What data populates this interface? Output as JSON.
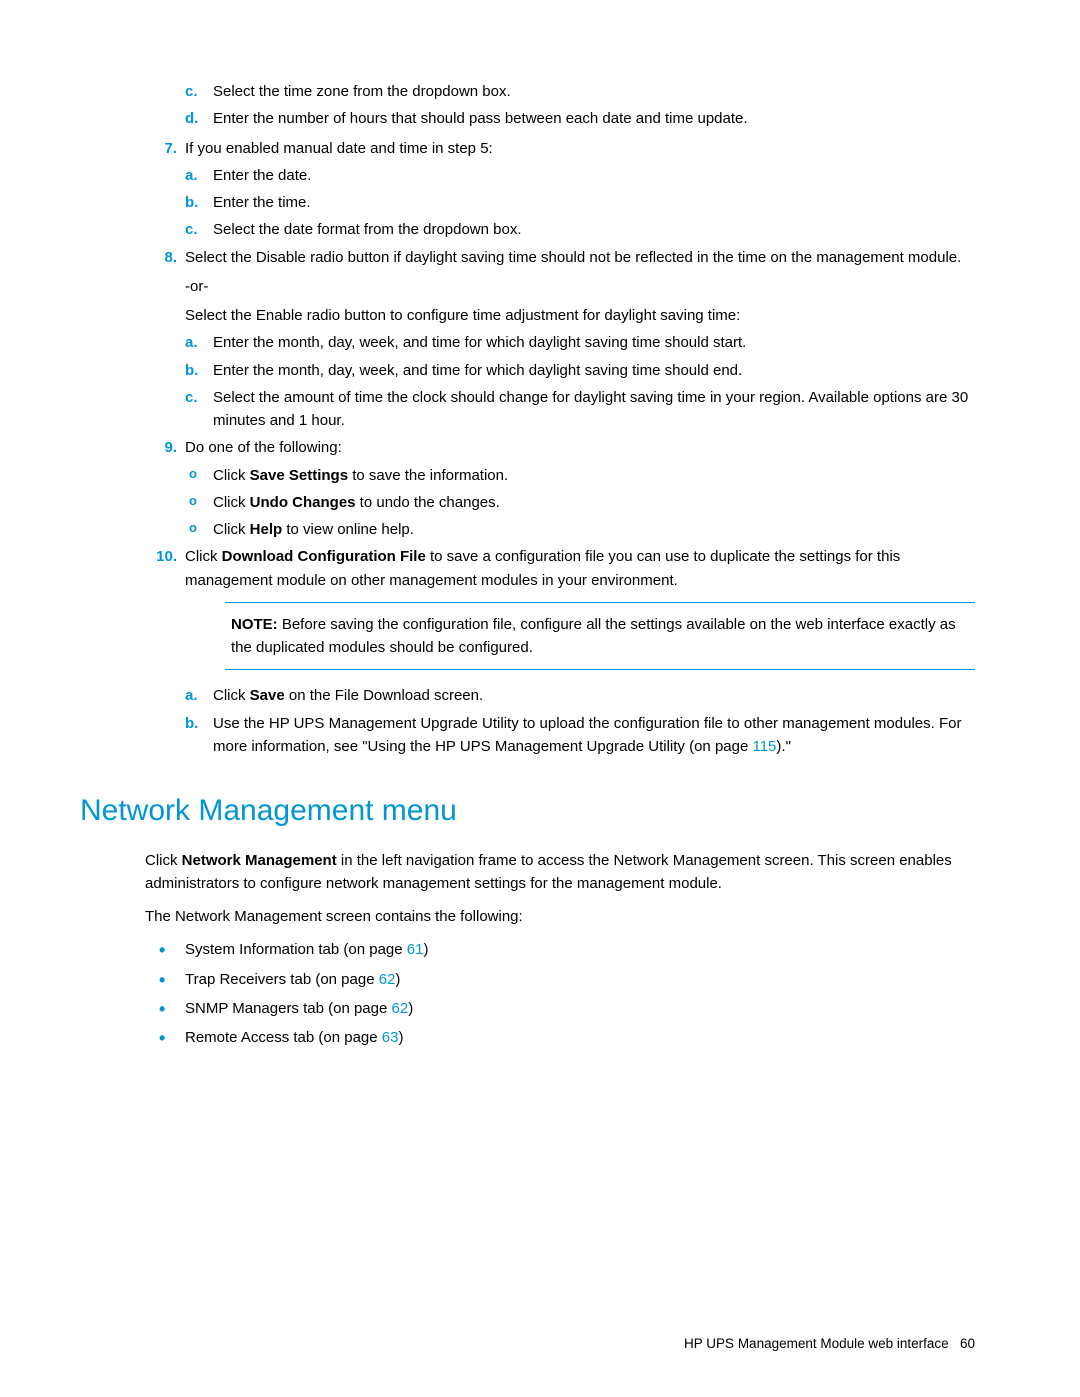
{
  "orphan_sub": [
    {
      "letter": "c.",
      "text": "Select the time zone from the dropdown box."
    },
    {
      "letter": "d.",
      "text": "Enter the number of hours that should pass between each date and time update."
    }
  ],
  "step7": {
    "num": "7.",
    "intro": "If you enabled manual date and time in step 5:",
    "sub": [
      {
        "letter": "a.",
        "text": "Enter the date."
      },
      {
        "letter": "b.",
        "text": "Enter the time."
      },
      {
        "letter": "c.",
        "text": "Select the date format from the dropdown box."
      }
    ]
  },
  "step8": {
    "num": "8.",
    "para1": "Select the Disable radio button if daylight saving time should not be reflected in the time on the management module.",
    "or": "-or-",
    "para2": "Select the Enable radio button to configure time adjustment for daylight saving time:",
    "sub": [
      {
        "letter": "a.",
        "text": "Enter the month, day, week, and time for which daylight saving time should start."
      },
      {
        "letter": "b.",
        "text": "Enter the month, day, week, and time for which daylight saving time should end."
      },
      {
        "letter": "c.",
        "text": "Select the amount of time the clock should change for daylight saving time in your region. Available options are 30 minutes and 1 hour."
      }
    ]
  },
  "step9": {
    "num": "9.",
    "intro": "Do one of the following:",
    "opts": [
      {
        "prefix": "Click ",
        "bold": "Save Settings",
        "suffix": " to save the information."
      },
      {
        "prefix": "Click ",
        "bold": "Undo Changes",
        "suffix": " to undo the changes."
      },
      {
        "prefix": "Click ",
        "bold": "Help",
        "suffix": " to view online help."
      }
    ]
  },
  "step10": {
    "num": "10.",
    "prefix": "Click ",
    "bold": "Download Configuration File",
    "suffix": " to save a configuration file you can use to duplicate the settings for this management module on other management modules in your environment.",
    "note_label": "NOTE:",
    "note_text": "  Before saving the configuration file, configure all the settings available on the web interface exactly as the duplicated modules should be configured.",
    "sub_a": {
      "letter": "a.",
      "prefix": "Click ",
      "bold": "Save",
      "suffix": " on the File Download screen."
    },
    "sub_b": {
      "letter": "b.",
      "text_before": "Use the HP UPS Management Upgrade Utility to upload the configuration file to other management modules. For more information, see \"Using the HP UPS Management Upgrade Utility (on page ",
      "link": "115",
      "text_after": ").\""
    }
  },
  "section_heading": "Network Management menu",
  "nm_para1_prefix": "Click ",
  "nm_para1_bold": "Network Management",
  "nm_para1_suffix": " in the left navigation frame to access the Network Management screen. This screen enables administrators to configure network management settings for the management module.",
  "nm_para2": "The Network Management screen contains the following:",
  "nm_tabs": [
    {
      "prefix": "System Information tab (on page ",
      "link": "61",
      "suffix": ")"
    },
    {
      "prefix": "Trap Receivers tab (on page ",
      "link": "62",
      "suffix": ")"
    },
    {
      "prefix": "SNMP Managers tab (on page ",
      "link": "62",
      "suffix": ")"
    },
    {
      "prefix": "Remote Access tab (on page ",
      "link": "63",
      "suffix": ")"
    }
  ],
  "footer_text": "HP UPS Management Module web interface",
  "footer_page": "60"
}
